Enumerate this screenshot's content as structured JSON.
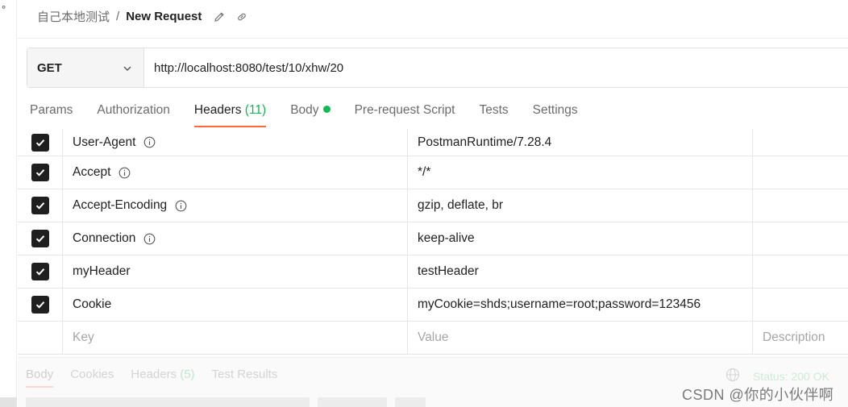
{
  "breadcrumb": {
    "collection": "自己本地测试",
    "separator": "/",
    "request": "New Request"
  },
  "request": {
    "method": "GET",
    "url": "http://localhost:8080/test/10/xhw/20"
  },
  "tabs": [
    {
      "label": "Params"
    },
    {
      "label": "Authorization"
    },
    {
      "label": "Headers",
      "count": "(11)",
      "active": true
    },
    {
      "label": "Body",
      "indicator": "green-dot"
    },
    {
      "label": "Pre-request Script"
    },
    {
      "label": "Tests"
    },
    {
      "label": "Settings"
    }
  ],
  "headers": [
    {
      "key": "User-Agent",
      "value": "PostmanRuntime/7.28.4",
      "info": true,
      "checked": true
    },
    {
      "key": "Accept",
      "value": "*/*",
      "info": true,
      "checked": true
    },
    {
      "key": "Accept-Encoding",
      "value": "gzip, deflate, br",
      "info": true,
      "checked": true
    },
    {
      "key": "Connection",
      "value": "keep-alive",
      "info": true,
      "checked": true
    },
    {
      "key": "myHeader",
      "value": "testHeader",
      "info": false,
      "checked": true
    },
    {
      "key": "Cookie",
      "value": "myCookie=shds;username=root;password=123456",
      "info": false,
      "checked": true
    }
  ],
  "placeholders": {
    "key": "Key",
    "value": "Value",
    "description": "Description"
  },
  "response": {
    "tabs": [
      "Body",
      "Cookies",
      "Headers",
      "Test Results"
    ],
    "headers_count": "(5)",
    "status": "Status: 200 OK"
  },
  "watermark": "CSDN @你的小伙伴啊",
  "colors": {
    "accent": "#ff6c37",
    "success": "#0cbb52",
    "checkbox": "#1f1f1f"
  },
  "icons": {
    "edit": "pencil-icon",
    "link": "link-icon",
    "dropdown": "chevron-down-icon",
    "info": "info-icon",
    "globe": "globe-icon"
  }
}
